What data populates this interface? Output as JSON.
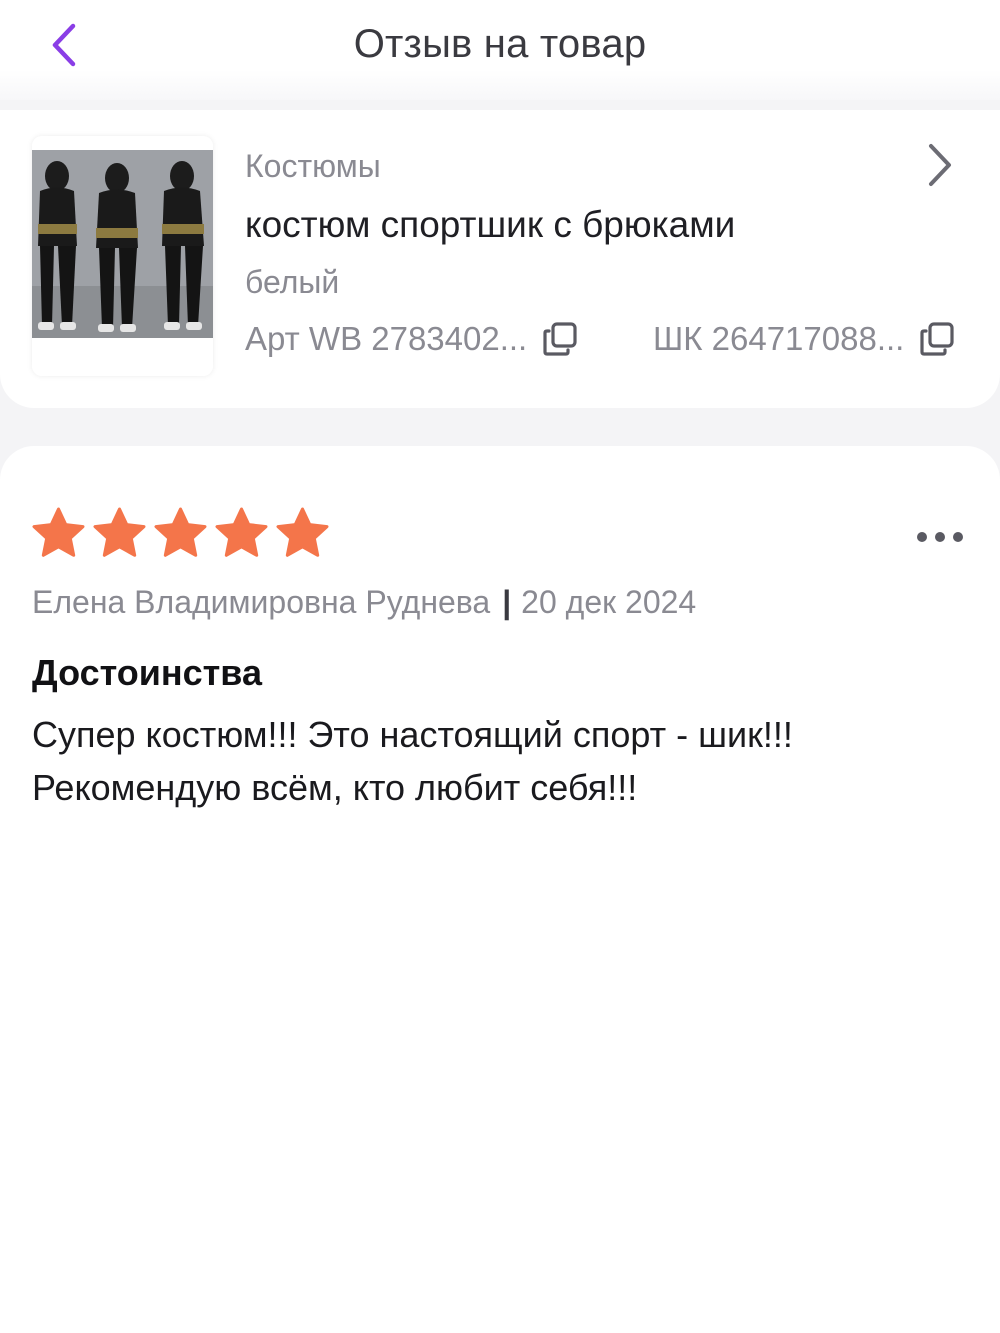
{
  "header": {
    "title": "Отзыв на товар",
    "back_icon": "chevron-left-icon",
    "accent_color": "#8a3ee6"
  },
  "product": {
    "category": "Костюмы",
    "name": "костюм спортшик с брюками",
    "color": "белый",
    "article": "Арт WB 2783402...",
    "barcode": "ШК 264717088...",
    "open_icon": "chevron-right-icon",
    "copy_icon": "copy-icon"
  },
  "review": {
    "rating": 5,
    "rating_max": 5,
    "star_color": "#f4754a",
    "author": "Елена Владимировна Руднева",
    "separator": "|",
    "date": "20 дек 2024",
    "more_icon": "more-horizontal-icon",
    "section_title": "Достоинства",
    "text_lines": [
      "Супер костюм!!! Это настоящий спорт - шик!!!",
      "Рекомендую всём, кто любит себя!!!"
    ]
  }
}
